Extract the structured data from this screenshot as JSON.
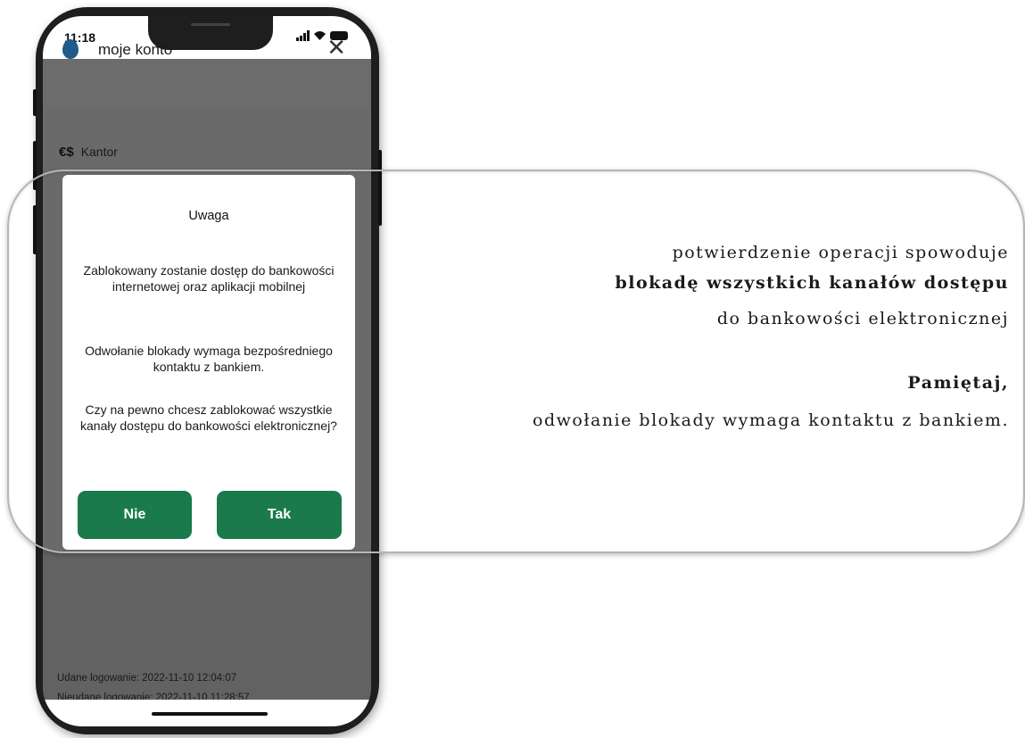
{
  "status_bar": {
    "time": "11:18"
  },
  "header": {
    "title": "moje konto"
  },
  "menu": {
    "kantor_label": "Kantor"
  },
  "modal": {
    "title": "Uwaga",
    "paragraph1": "Zablokowany zostanie dostęp do bankowości internetowej oraz aplikacji mobilnej",
    "paragraph2": "Odwołanie blokady wymaga bezpośredniego kontaktu z bankiem.",
    "paragraph3": "Czy na pewno chcesz zablokować wszystkie kanały dostępu do bankowości elektronicznej?",
    "no_label": "Nie",
    "yes_label": "Tak"
  },
  "login_info": {
    "success": "Udane logowanie: 2022-11-10 12:04:07",
    "failed": "Nieudane logowanie: 2022-11-10 11:28:57"
  },
  "callout": {
    "line1": "potwierdzenie operacji spowoduje",
    "line2": "blokadę wszystkich kanałów dostępu",
    "line3": "do bankowości elektronicznej",
    "line4": "Pamiętaj,",
    "line5": "odwołanie blokady wymaga kontaktu z bankiem."
  },
  "colors": {
    "accent_green": "#1a7a4c",
    "overlay_gray": "#6a6a6a",
    "logo_blue": "#1e5b8a"
  },
  "icons": {
    "close": "close-icon",
    "currency": "currency-exchange-icon",
    "logo": "balloon-logo-icon"
  }
}
